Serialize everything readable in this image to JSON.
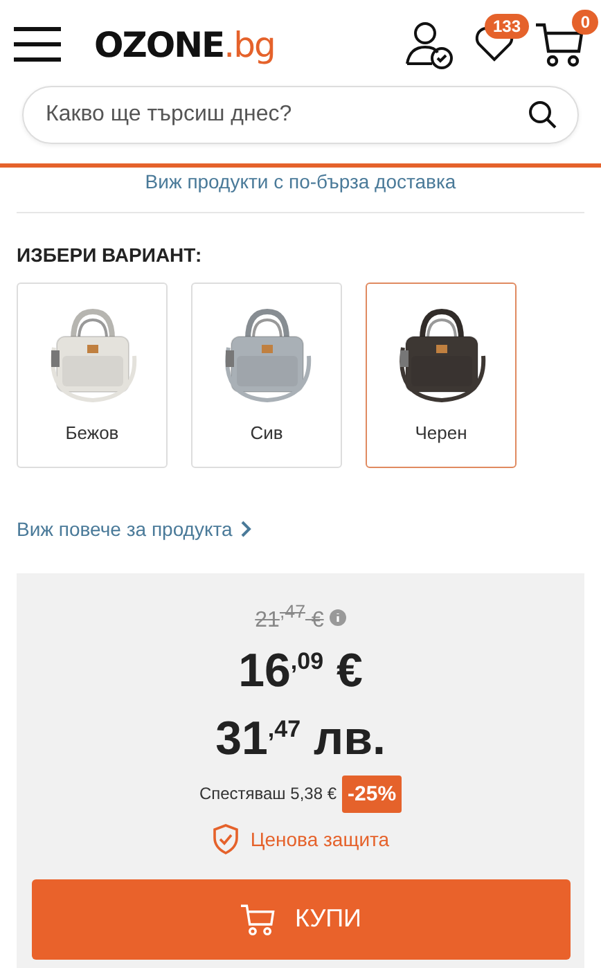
{
  "header": {
    "logo_main": "OZONE",
    "logo_suffix": ".bg",
    "wishlist_count": "133",
    "cart_count": "0"
  },
  "search": {
    "placeholder": "Какво ще търсиш днес?"
  },
  "delivery_link": "Виж продукти с по-бърза доставка",
  "variants": {
    "title": "ИЗБЕРИ ВАРИАНТ:",
    "items": [
      {
        "label": "Бежов",
        "selected": false,
        "color": "#e4e2dc"
      },
      {
        "label": "Сив",
        "selected": false,
        "color": "#a9b0b6"
      },
      {
        "label": "Черен",
        "selected": true,
        "color": "#3d3733"
      }
    ]
  },
  "more_link": "Виж повече за продукта",
  "price": {
    "old": "21$^{,47}$ €",
    "eur": "16$^{,09}$ €",
    "bgn": "31$^{,47}$ лв.",
    "savings": "Спестяваш 5,38 €",
    "discount": "-25%",
    "protection": "Ценова защита",
    "buy": "КУПИ"
  }
}
